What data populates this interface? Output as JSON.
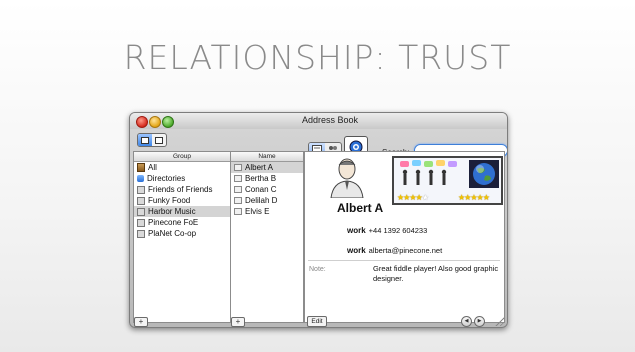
{
  "slide": {
    "title": "RELATIONSHIP:  TRUST"
  },
  "window": {
    "title": "Address Book"
  },
  "toolbar": {
    "search_label": "Search:",
    "search_value": ""
  },
  "groups": {
    "header": "Group",
    "items": [
      {
        "label": "All",
        "icon": "all-icon"
      },
      {
        "label": "Directories",
        "icon": "directories-icon"
      },
      {
        "label": "Friends of Friends",
        "icon": "group-icon"
      },
      {
        "label": "Funky Food",
        "icon": "group-icon"
      },
      {
        "label": "Harbor Music",
        "icon": "group-icon",
        "selected": true
      },
      {
        "label": "Pinecone FoE",
        "icon": "group-icon"
      },
      {
        "label": "PlaNet Co-op",
        "icon": "group-icon"
      }
    ],
    "add_label": "+"
  },
  "names": {
    "header": "Name",
    "items": [
      {
        "label": "Albert A",
        "selected": true
      },
      {
        "label": "Bertha B"
      },
      {
        "label": "Conan C"
      },
      {
        "label": "Delilah D"
      },
      {
        "label": "Elvis E"
      }
    ],
    "add_label": "+"
  },
  "card": {
    "name": "Albert A",
    "trust_ratings": [
      {
        "stars": 4,
        "max": 5
      },
      {
        "stars": 5,
        "max": 5
      }
    ],
    "fields": [
      {
        "label": "work",
        "value": "+44 1392 604233"
      },
      {
        "label": "work",
        "value": "alberta@pinecone.net"
      }
    ],
    "note_label": "Note:",
    "note": "Great fiddle player! Also good graphic designer.",
    "edit_label": "Edit"
  },
  "colors": {
    "selection_blue": "#3f86e6",
    "star_gold": "#f3c300"
  }
}
